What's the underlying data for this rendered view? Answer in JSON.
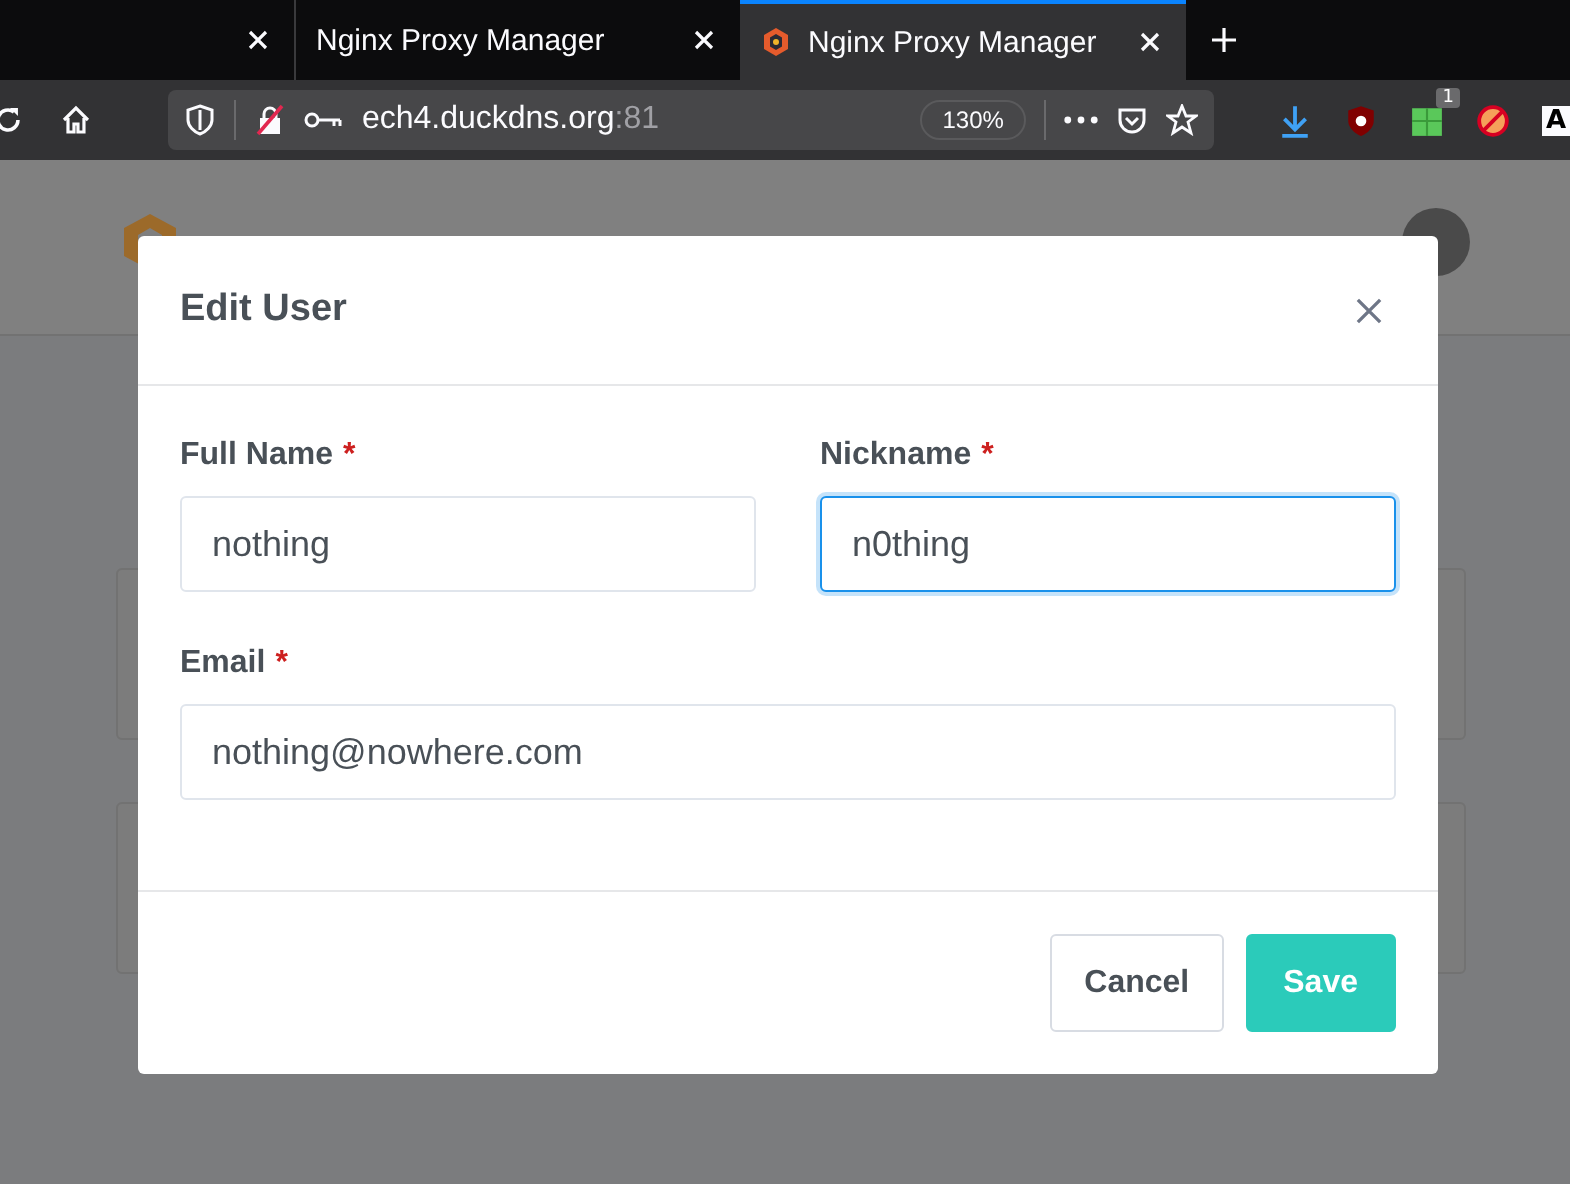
{
  "browser": {
    "tabs": [
      {
        "selected": false
      },
      {
        "title": "Nginx Proxy Manager",
        "selected": false
      },
      {
        "title": "Nginx Proxy Manager",
        "selected": true
      }
    ],
    "url": {
      "host": "ech4.duckdns.org",
      "port": ":81"
    },
    "zoom": "130%",
    "extension_badge": "1",
    "edge_label": "A"
  },
  "modal": {
    "title": "Edit User",
    "required_mark": "*",
    "rows": [
      [
        {
          "label": "Full Name",
          "required": true,
          "value": "nothing",
          "focused": false
        },
        {
          "label": "Nickname",
          "required": true,
          "value": "n0thing",
          "focused": true
        }
      ],
      [
        {
          "label": "Email",
          "required": true,
          "value": "nothing@nowhere.com",
          "focused": false
        }
      ]
    ],
    "buttons": [
      {
        "label": "Cancel",
        "kind": "secondary"
      },
      {
        "label": "Save",
        "kind": "primary"
      }
    ]
  }
}
